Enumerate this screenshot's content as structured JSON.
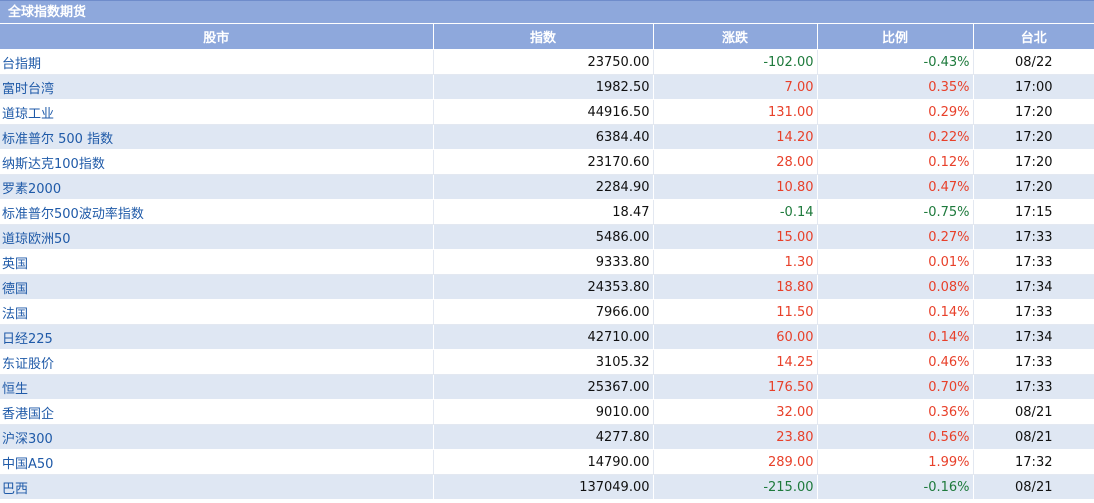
{
  "title": "全球指数期货",
  "headers": {
    "market": "股市",
    "index": "指数",
    "change": "涨跌",
    "ratio": "比例",
    "time": "台北"
  },
  "colors": {
    "header_bg": "#8ea8dc",
    "row_alt_bg": "#dfe7f3",
    "up": "#e8402a",
    "down": "#1e7a3c",
    "link": "#1f5aa8"
  },
  "rows": [
    {
      "name": "台指期",
      "index": "23750.00",
      "change": "-102.00",
      "ratio": "-0.43%",
      "time": "08/22",
      "dir": "down"
    },
    {
      "name": "富时台湾",
      "index": "1982.50",
      "change": "7.00",
      "ratio": "0.35%",
      "time": "17:00",
      "dir": "up"
    },
    {
      "name": "道琼工业",
      "index": "44916.50",
      "change": "131.00",
      "ratio": "0.29%",
      "time": "17:20",
      "dir": "up"
    },
    {
      "name": "标准普尔 500 指数",
      "index": "6384.40",
      "change": "14.20",
      "ratio": "0.22%",
      "time": "17:20",
      "dir": "up"
    },
    {
      "name": "纳斯达克100指数",
      "index": "23170.60",
      "change": "28.00",
      "ratio": "0.12%",
      "time": "17:20",
      "dir": "up"
    },
    {
      "name": "罗素2000",
      "index": "2284.90",
      "change": "10.80",
      "ratio": "0.47%",
      "time": "17:20",
      "dir": "up"
    },
    {
      "name": "标准普尔500波动率指数",
      "index": "18.47",
      "change": "-0.14",
      "ratio": "-0.75%",
      "time": "17:15",
      "dir": "down"
    },
    {
      "name": "道琼欧洲50",
      "index": "5486.00",
      "change": "15.00",
      "ratio": "0.27%",
      "time": "17:33",
      "dir": "up"
    },
    {
      "name": "英国",
      "index": "9333.80",
      "change": "1.30",
      "ratio": "0.01%",
      "time": "17:33",
      "dir": "up"
    },
    {
      "name": "德国",
      "index": "24353.80",
      "change": "18.80",
      "ratio": "0.08%",
      "time": "17:34",
      "dir": "up"
    },
    {
      "name": "法国",
      "index": "7966.00",
      "change": "11.50",
      "ratio": "0.14%",
      "time": "17:33",
      "dir": "up"
    },
    {
      "name": "日经225",
      "index": "42710.00",
      "change": "60.00",
      "ratio": "0.14%",
      "time": "17:34",
      "dir": "up"
    },
    {
      "name": "东证股价",
      "index": "3105.32",
      "change": "14.25",
      "ratio": "0.46%",
      "time": "17:33",
      "dir": "up"
    },
    {
      "name": "恒生",
      "index": "25367.00",
      "change": "176.50",
      "ratio": "0.70%",
      "time": "17:33",
      "dir": "up"
    },
    {
      "name": "香港国企",
      "index": "9010.00",
      "change": "32.00",
      "ratio": "0.36%",
      "time": "08/21",
      "dir": "up"
    },
    {
      "name": "沪深300",
      "index": "4277.80",
      "change": "23.80",
      "ratio": "0.56%",
      "time": "08/21",
      "dir": "up"
    },
    {
      "name": "中国A50",
      "index": "14790.00",
      "change": "289.00",
      "ratio": "1.99%",
      "time": "17:32",
      "dir": "up"
    },
    {
      "name": "巴西",
      "index": "137049.00",
      "change": "-215.00",
      "ratio": "-0.16%",
      "time": "08/21",
      "dir": "down"
    }
  ]
}
